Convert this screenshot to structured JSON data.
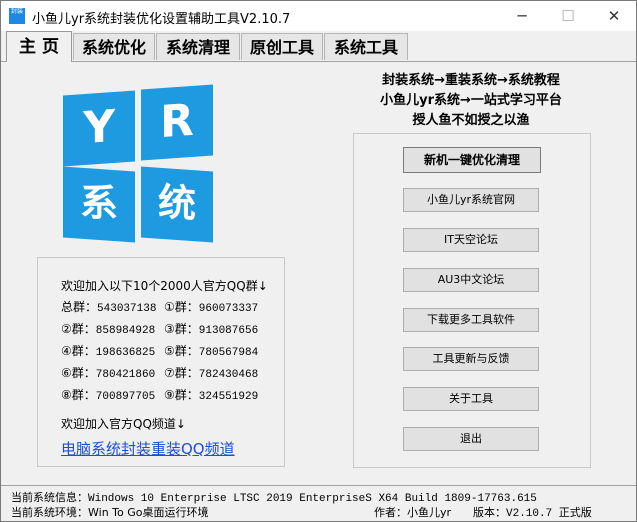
{
  "window": {
    "title": "小鱼儿yr系统封装优化设置辅助工具V2.10.7",
    "icon_label": "封装"
  },
  "tabs": [
    {
      "label": "主 页",
      "active": true
    },
    {
      "label": "系统优化",
      "active": false
    },
    {
      "label": "系统清理",
      "active": false
    },
    {
      "label": "原创工具",
      "active": false
    },
    {
      "label": "系统工具",
      "active": false
    }
  ],
  "logo": {
    "tile1": "Y",
    "tile2": "R",
    "tile3": "系",
    "tile4": "统",
    "color": "#1e9be0"
  },
  "qq": {
    "header": "欢迎加入以下10个2000人官方QQ群↓",
    "rows": [
      {
        "l_label": "总群：",
        "l_num": "543037138",
        "r_label": "①群：",
        "r_num": "960073337"
      },
      {
        "l_label": "②群：",
        "l_num": "858984928",
        "r_label": "③群：",
        "r_num": "913087656"
      },
      {
        "l_label": "④群：",
        "l_num": "198636825",
        "r_label": "⑤群：",
        "r_num": "780567984"
      },
      {
        "l_label": "⑥群：",
        "l_num": "780421860",
        "r_label": "⑦群：",
        "r_num": "782430468"
      },
      {
        "l_label": "⑧群：",
        "l_num": "700897705",
        "r_label": "⑨群：",
        "r_num": "324551929"
      }
    ],
    "channel_text": "欢迎加入官方QQ频道↓",
    "channel_link": "电脑系统封装重装QQ频道",
    "link_color": "#1a4fd6"
  },
  "slogans": [
    "封装系统→重装系统→系统教程",
    "小鱼儿yr系统→一站式学习平台",
    "授人鱼不如授之以渔"
  ],
  "buttons": {
    "optimize": "新机一键优化清理",
    "website": "小鱼儿yr系统官网",
    "it_forum": "IT天空论坛",
    "au3_forum": "AU3中文论坛",
    "download_more": "下载更多工具软件",
    "update_feedback": "工具更新与反馈",
    "about": "关于工具",
    "exit": "退出"
  },
  "status": {
    "sysinfo_label": "当前系统信息：",
    "sysinfo_value": "Windows 10 Enterprise LTSC 2019 EnterpriseS X64 Build 1809-17763.615",
    "env_label": "当前系统环境：",
    "env_value": "Win To Go桌面运行环境",
    "author_label": "作者：",
    "author_value": "小鱼儿yr",
    "version_label": "版本：",
    "version_value": "V2.10.7 正式版"
  }
}
